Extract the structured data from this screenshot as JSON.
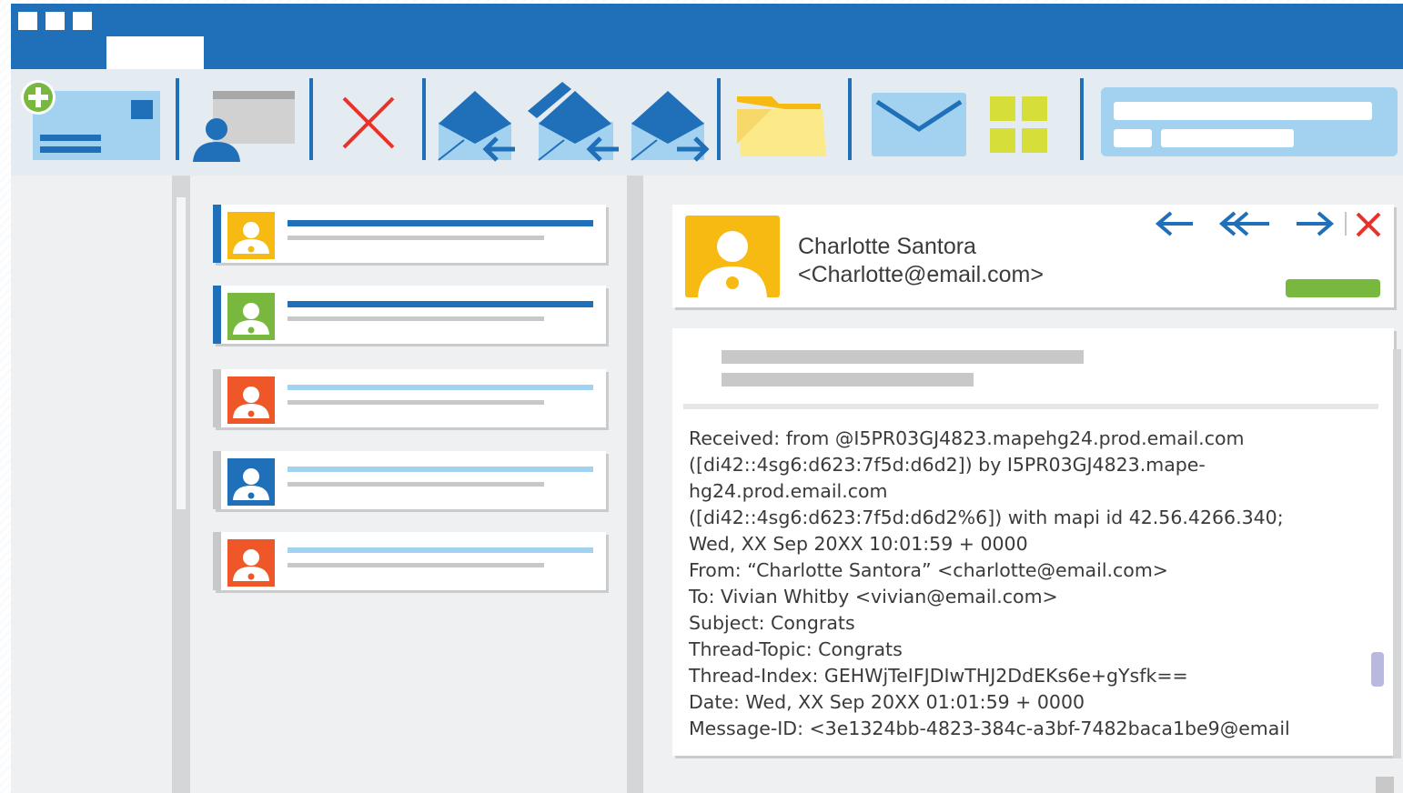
{
  "window": {
    "accent_color": "#1f6fb9",
    "title_buttons": [
      "window-button",
      "window-button",
      "window-button"
    ]
  },
  "toolbar": {
    "items": [
      {
        "name": "new-message",
        "icon": "new-message-icon"
      },
      {
        "name": "contacts",
        "icon": "contacts-icon"
      },
      {
        "name": "delete",
        "icon": "delete-icon"
      },
      {
        "name": "reply",
        "icon": "reply-icon"
      },
      {
        "name": "reply-all",
        "icon": "reply-all-icon"
      },
      {
        "name": "forward",
        "icon": "forward-icon"
      },
      {
        "name": "folder",
        "icon": "folder-icon"
      },
      {
        "name": "mail",
        "icon": "mail-icon"
      },
      {
        "name": "apps",
        "icon": "grid-icon"
      }
    ]
  },
  "message_list": [
    {
      "avatar_color": "#f7ba12",
      "stripe_color": "#1f6fb9",
      "line_color": "#1f6fb9",
      "unread": true
    },
    {
      "avatar_color": "#78b83e",
      "stripe_color": "#1f6fb9",
      "line_color": "#1f6fb9",
      "unread": true
    },
    {
      "avatar_color": "#ef5628",
      "stripe_color": "#c8c8c8",
      "line_color": "#a3d2f0",
      "unread": false
    },
    {
      "avatar_color": "#1f6fb9",
      "stripe_color": "#c8c8c8",
      "line_color": "#a3d2f0",
      "unread": false
    },
    {
      "avatar_color": "#ef5628",
      "stripe_color": "#c8c8c8",
      "line_color": "#a3d2f0",
      "unread": false
    }
  ],
  "reading_pane": {
    "sender_name": "Charlotte Santora",
    "sender_email": "<Charlotte@email.com>",
    "nav_icons": [
      "reply-arrow-icon",
      "reply-all-arrow-icon",
      "forward-arrow-icon",
      "close-icon"
    ],
    "headers": [
      "Received: from @I5PR03GJ4823.mapehg24.prod.email.com",
      "([di42::4sg6:d623:7f5d:d6d2]) by I5PR03GJ4823.mape-",
      "hg24.prod.email.com",
      "([di42::4sg6:d623:7f5d:d6d2%6]) with mapi id 42.56.4266.340;",
      "Wed, XX Sep 20XX 10:01:59 + 0000",
      "From: “Charlotte Santora” <charlotte@email.com>",
      "To: Vivian Whitby <vivian@email.com>",
      "Subject: Congrats",
      "Thread-Topic: Congrats",
      "Thread-Index:  GEHWjTeIFJDIwTHJ2DdEKs6e+gYsfk==",
      "Date: Wed, XX Sep 20XX 01:01:59 + 0000",
      "Message-ID: <3e1324bb-4823-384c-a3bf-7482baca1be9@email"
    ]
  }
}
